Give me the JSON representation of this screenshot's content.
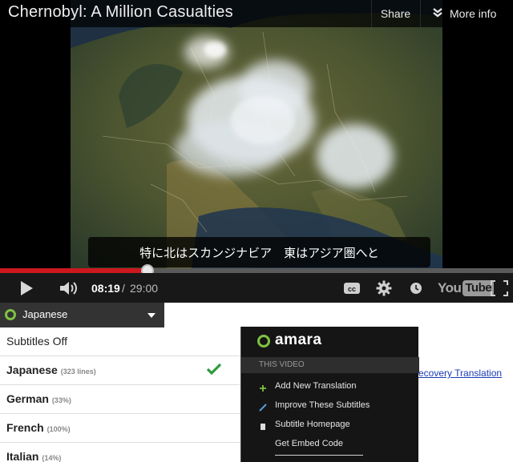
{
  "player": {
    "title": "Chernobyl: A Million Casualties",
    "share_label": "Share",
    "more_info_label": "More info",
    "subtitle_text": "特に北はスカンジナビア　東はアジア圏へと",
    "time_current": "08:19",
    "time_separator": "/",
    "time_total": "29:00",
    "progress": 0.287,
    "logo_you": "You",
    "logo_tube": "Tube",
    "accent_color": "#cc181e"
  },
  "language_panel": {
    "selected_language": "Japanese",
    "items": [
      {
        "name": "Subtitles Off",
        "meta": "",
        "active": false
      },
      {
        "name": "Japanese",
        "meta": "(323 lines)",
        "active": true
      },
      {
        "name": "German",
        "meta": "(33%)",
        "active": false
      },
      {
        "name": "French",
        "meta": "(100%)",
        "active": false
      },
      {
        "name": "Italian",
        "meta": "(14%)",
        "active": false
      }
    ],
    "accent_color": "#7fc241"
  },
  "amara_menu": {
    "brand": "amara",
    "section_label": "THIS VIDEO",
    "items": [
      {
        "label": "Add New Translation",
        "icon": "plus-icon"
      },
      {
        "label": "Improve These Subtitles",
        "icon": "pencil-icon"
      },
      {
        "label": "Subtitle Homepage",
        "icon": "page-icon"
      },
      {
        "label": "Get Embed Code",
        "icon": ""
      }
    ]
  },
  "background_link": {
    "text": "ecovery Translation"
  }
}
